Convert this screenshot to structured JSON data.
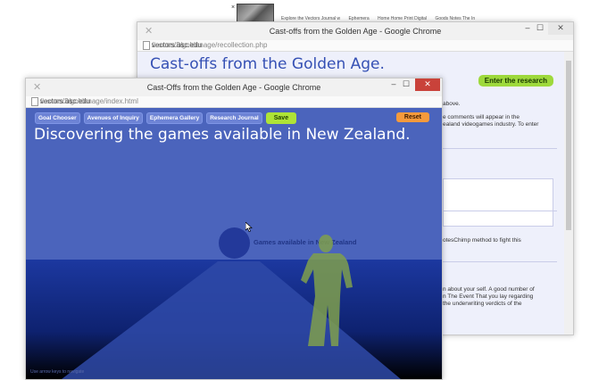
{
  "background": {
    "tabs": [
      "Explore the Vectors Journal w",
      "Ephemera",
      "Home Home Print Digital",
      "Goods Notes The In"
    ]
  },
  "back_window": {
    "title": "Cast-offs from the Golden Age - Google Chrome",
    "url_host": "vectors.usc.edu",
    "url_path": "/issues/3/goldenage/recollection.php",
    "heading": "Cast-offs from the Golden Age.",
    "enter_button": "Enter the research",
    "snippets": [
      "above.",
      "e comments will appear in the",
      "ealand videogames industry. To enter",
      "otesChimp method to fight this",
      "n about your self. A good number of",
      "n The Event That you lay regarding",
      "the underwriting verdicts of the"
    ]
  },
  "front_window": {
    "title": "Cast-Offs from the Golden Age - Google Chrome",
    "url_host": "vectors.usc.edu",
    "url_path": "/issues/3/goldenage/index.html",
    "nav": [
      "Goal Chooser",
      "Avenues of Inquiry",
      "Ephemera Gallery",
      "Research Journal"
    ],
    "save_label": "Save",
    "reset_label": "Reset",
    "heading": "Discovering the games available in New Zealand.",
    "games_label": "Games available in New Zealand",
    "hint": "Use arrow keys to navigate"
  },
  "window_controls": {
    "minimize": "–",
    "maximize": "☐",
    "close": "✕"
  },
  "colors": {
    "scene_bg": "#4b64bc",
    "floor": "#1c38a0",
    "save": "#aee337",
    "reset": "#f59a3c",
    "accent_heading": "#3550b4"
  }
}
